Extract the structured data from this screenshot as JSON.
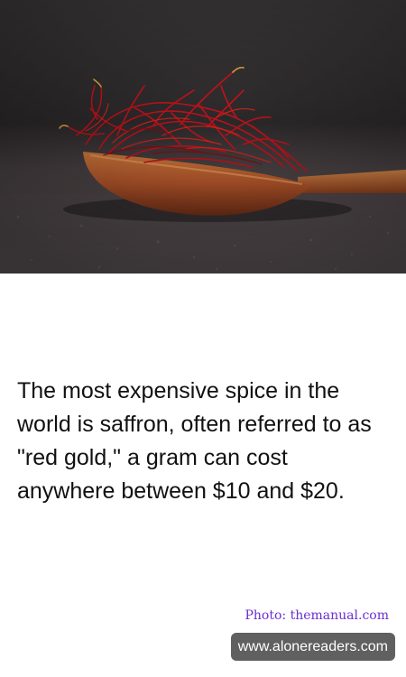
{
  "hero_image": {
    "description_icon": "saffron-on-wooden-spoon-photo"
  },
  "fact": {
    "text": "The most expensive spice in the world is saffron, often referred to as \"red gold,\" a gram can cost anywhere between $10 and $20."
  },
  "credit": {
    "text": "Photo: themanual.com"
  },
  "source": {
    "text": "www.alonereaders.com"
  },
  "colors": {
    "credit": "#6a2fd1",
    "badge_bg": "#606060",
    "saffron": "#c3121b",
    "spoon": "#b85a2b"
  }
}
